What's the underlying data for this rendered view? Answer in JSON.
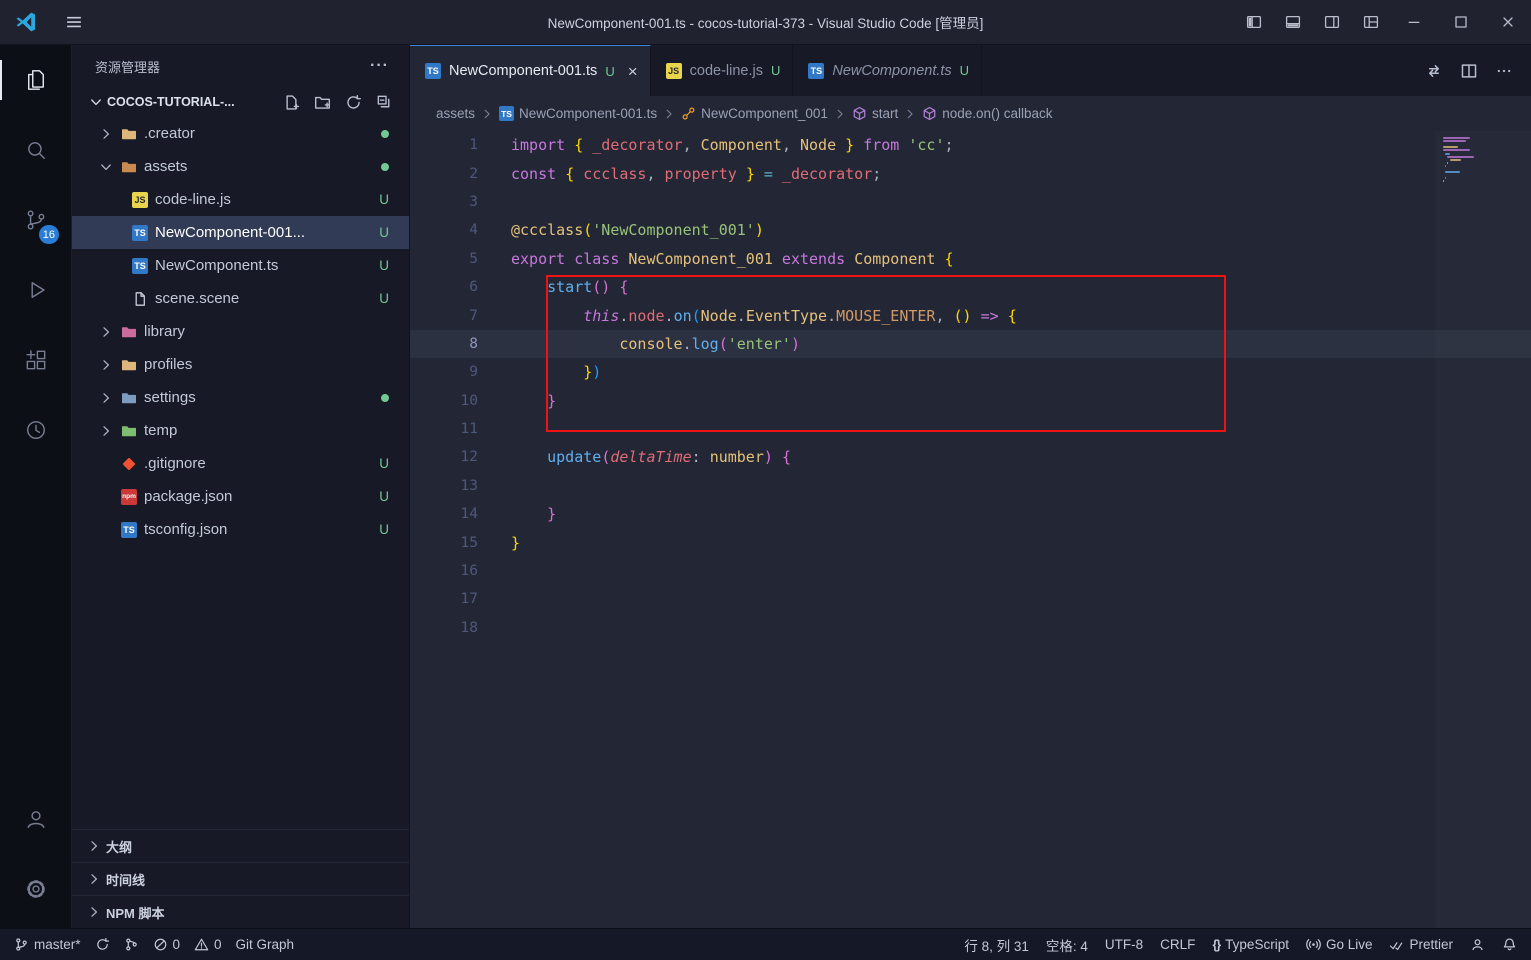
{
  "colors": {
    "accent_blue": "#3794ff",
    "badge_blue": "#2a7cd4",
    "git_green": "#73c991",
    "annotation_red": "#ee1212",
    "ts_blue": "#3178c6",
    "js_yellow": "#e8d44d",
    "npm_red": "#cb3837"
  },
  "title_bar": {
    "title": "NewComponent-001.ts - cocos-tutorial-373 - Visual Studio Code [管理员]",
    "controls": [
      "layout-sidebar-left-icon",
      "layout-panel-icon",
      "layout-sidebar-right-icon",
      "layout-customize-icon",
      "minimize-icon",
      "maximize-icon",
      "close-icon"
    ]
  },
  "activity_bar": {
    "items": [
      {
        "name": "explorer",
        "icon": "files-icon",
        "active": true
      },
      {
        "name": "search",
        "icon": "search-icon"
      },
      {
        "name": "source-control",
        "icon": "source-control-icon",
        "badge": "16"
      },
      {
        "name": "run-debug",
        "icon": "run-debug-icon"
      },
      {
        "name": "extensions",
        "icon": "extensions-icon"
      },
      {
        "name": "history",
        "icon": "history-icon"
      }
    ],
    "bottom_items": [
      {
        "name": "account",
        "icon": "account-icon"
      },
      {
        "name": "settings",
        "icon": "settings-gear-icon"
      }
    ]
  },
  "explorer": {
    "title": "资源管理器",
    "more_label": "···",
    "root": "COCOS-TUTORIAL-...",
    "root_actions": [
      "new-file-icon",
      "new-folder-icon",
      "refresh-icon",
      "collapse-all-icon"
    ],
    "items": [
      {
        "label": ".creator",
        "icon": "folder-icon",
        "color": "#dcb67a",
        "chevron": "right",
        "level": 1,
        "dot": true
      },
      {
        "label": "assets",
        "icon": "folder-icon",
        "color": "#c98a52",
        "chevron": "down",
        "level": 1,
        "dot": true
      },
      {
        "label": "code-line.js",
        "icon": "js-icon",
        "level": 2,
        "badge": "U"
      },
      {
        "label": "NewComponent-001...",
        "icon": "ts-icon",
        "level": 2,
        "badge": "U",
        "selected": true
      },
      {
        "label": "NewComponent.ts",
        "icon": "ts-icon",
        "level": 2,
        "badge": "U"
      },
      {
        "label": "scene.scene",
        "icon": "file-icon",
        "color": "#c8ccda",
        "level": 2,
        "badge": "U"
      },
      {
        "label": "library",
        "icon": "folder-icon",
        "color": "#cc6b9e",
        "chevron": "right",
        "level": 1
      },
      {
        "label": "profiles",
        "icon": "folder-icon",
        "color": "#dcb67a",
        "chevron": "right",
        "level": 1
      },
      {
        "label": "settings",
        "icon": "folder-icon",
        "color": "#7e9cc0",
        "chevron": "right",
        "level": 1,
        "dot": true
      },
      {
        "label": "temp",
        "icon": "folder-icon",
        "color": "#7ebd6f",
        "chevron": "right",
        "level": 1
      },
      {
        "label": ".gitignore",
        "icon": "git-icon",
        "color": "#f05033",
        "level": 1,
        "badge": "U"
      },
      {
        "label": "package.json",
        "icon": "npm-icon",
        "level": 1,
        "badge": "U"
      },
      {
        "label": "tsconfig.json",
        "icon": "ts-icon",
        "level": 1,
        "badge": "U"
      }
    ],
    "sections": [
      "大纲",
      "时间线",
      "NPM 脚本"
    ]
  },
  "editor": {
    "tabs": [
      {
        "label": "NewComponent-001.ts",
        "icon": "ts-icon",
        "badge": "U",
        "active": true
      },
      {
        "label": "code-line.js",
        "icon": "js-icon",
        "badge": "U"
      },
      {
        "label": "NewComponent.ts",
        "icon": "ts-icon",
        "badge": "U",
        "preview": true
      }
    ],
    "tab_actions": [
      "open-changes-icon",
      "split-editor-icon",
      "more-actions-icon"
    ],
    "breadcrumbs": [
      {
        "label": "assets"
      },
      {
        "label": "NewComponent-001.ts",
        "icon": "ts-icon"
      },
      {
        "label": "NewComponent_001",
        "icon": "symbol-class-icon",
        "icon_color": "#ee9d28"
      },
      {
        "label": "start",
        "icon": "symbol-method-icon",
        "icon_color": "#b180d7"
      },
      {
        "label": "node.on() callback",
        "icon": "symbol-method-icon",
        "icon_color": "#b180d7"
      }
    ],
    "current_line": 8,
    "token_colors": {
      "kw": "#c678dd",
      "red": "#e06c75",
      "yel": "#e5c07b",
      "str": "#98c379",
      "blue": "#61afef",
      "org": "#d19a66",
      "cyan": "#56b6c2",
      "fg": "#abb2bf",
      "b1": "#ffd700",
      "b2": "#da70d6",
      "b3": "#179fff"
    },
    "lines": [
      {
        "n": 1,
        "tokens": [
          {
            "t": "import ",
            "c": "kw"
          },
          {
            "t": "{ ",
            "c": "b1"
          },
          {
            "t": "_decorator",
            "c": "red"
          },
          {
            "t": ", ",
            "c": "fg"
          },
          {
            "t": "Component",
            "c": "yel"
          },
          {
            "t": ", ",
            "c": "fg"
          },
          {
            "t": "Node",
            "c": "yel"
          },
          {
            "t": " ",
            "c": "fg"
          },
          {
            "t": "} ",
            "c": "b1"
          },
          {
            "t": "from ",
            "c": "kw"
          },
          {
            "t": "'cc'",
            "c": "str"
          },
          {
            "t": ";",
            "c": "fg"
          }
        ]
      },
      {
        "n": 2,
        "tokens": [
          {
            "t": "const ",
            "c": "kw"
          },
          {
            "t": "{ ",
            "c": "b1"
          },
          {
            "t": "ccclass",
            "c": "red"
          },
          {
            "t": ", ",
            "c": "fg"
          },
          {
            "t": "property",
            "c": "red"
          },
          {
            "t": " ",
            "c": "fg"
          },
          {
            "t": "} ",
            "c": "b1"
          },
          {
            "t": "= ",
            "c": "cyan"
          },
          {
            "t": "_decorator",
            "c": "red"
          },
          {
            "t": ";",
            "c": "fg"
          }
        ]
      },
      {
        "n": 3,
        "tokens": []
      },
      {
        "n": 4,
        "tokens": [
          {
            "t": "@ccclass",
            "c": "yel"
          },
          {
            "t": "(",
            "c": "b1"
          },
          {
            "t": "'NewComponent_001'",
            "c": "str"
          },
          {
            "t": ")",
            "c": "b1"
          }
        ]
      },
      {
        "n": 5,
        "tokens": [
          {
            "t": "export class ",
            "c": "kw"
          },
          {
            "t": "NewComponent_001",
            "c": "yel"
          },
          {
            "t": " extends ",
            "c": "kw"
          },
          {
            "t": "Component ",
            "c": "yel"
          },
          {
            "t": "{",
            "c": "b1"
          }
        ]
      },
      {
        "n": 6,
        "tokens": [
          {
            "t": "    ",
            "c": "fg"
          },
          {
            "t": "start",
            "c": "blue"
          },
          {
            "t": "() ",
            "c": "b2"
          },
          {
            "t": "{",
            "c": "b2"
          }
        ]
      },
      {
        "n": 7,
        "tokens": [
          {
            "t": "        ",
            "c": "fg"
          },
          {
            "t": "this",
            "c": "kw",
            "i": true
          },
          {
            "t": ".",
            "c": "fg"
          },
          {
            "t": "node",
            "c": "red"
          },
          {
            "t": ".",
            "c": "fg"
          },
          {
            "t": "on",
            "c": "blue"
          },
          {
            "t": "(",
            "c": "b3"
          },
          {
            "t": "Node",
            "c": "yel"
          },
          {
            "t": ".",
            "c": "fg"
          },
          {
            "t": "EventType",
            "c": "yel"
          },
          {
            "t": ".",
            "c": "fg"
          },
          {
            "t": "MOUSE_ENTER",
            "c": "org"
          },
          {
            "t": ", ",
            "c": "fg"
          },
          {
            "t": "()",
            "c": "b1"
          },
          {
            "t": " ",
            "c": "fg"
          },
          {
            "t": "=>",
            "c": "kw"
          },
          {
            "t": " ",
            "c": "fg"
          },
          {
            "t": "{",
            "c": "b1"
          }
        ]
      },
      {
        "n": 8,
        "tokens": [
          {
            "t": "            ",
            "c": "fg"
          },
          {
            "t": "console",
            "c": "yel"
          },
          {
            "t": ".",
            "c": "fg"
          },
          {
            "t": "log",
            "c": "blue"
          },
          {
            "t": "(",
            "c": "b2"
          },
          {
            "t": "'enter'",
            "c": "str"
          },
          {
            "t": ")",
            "c": "b2"
          }
        ]
      },
      {
        "n": 9,
        "tokens": [
          {
            "t": "        ",
            "c": "fg"
          },
          {
            "t": "}",
            "c": "b1"
          },
          {
            "t": ")",
            "c": "b3"
          }
        ]
      },
      {
        "n": 10,
        "tokens": [
          {
            "t": "    ",
            "c": "fg"
          },
          {
            "t": "}",
            "c": "b2"
          }
        ]
      },
      {
        "n": 11,
        "tokens": []
      },
      {
        "n": 12,
        "tokens": [
          {
            "t": "    ",
            "c": "fg"
          },
          {
            "t": "update",
            "c": "blue"
          },
          {
            "t": "(",
            "c": "b2"
          },
          {
            "t": "deltaTime",
            "c": "red",
            "i": true
          },
          {
            "t": ": ",
            "c": "fg"
          },
          {
            "t": "number",
            "c": "yel"
          },
          {
            "t": ") ",
            "c": "b2"
          },
          {
            "t": "{",
            "c": "b2"
          }
        ]
      },
      {
        "n": 13,
        "tokens": []
      },
      {
        "n": 14,
        "tokens": [
          {
            "t": "    ",
            "c": "fg"
          },
          {
            "t": "}",
            "c": "b2"
          }
        ]
      },
      {
        "n": 15,
        "tokens": [
          {
            "t": "}",
            "c": "b1"
          }
        ]
      },
      {
        "n": 16,
        "tokens": []
      },
      {
        "n": 17,
        "tokens": []
      },
      {
        "n": 18,
        "tokens": []
      }
    ]
  },
  "status_bar": {
    "left": [
      {
        "name": "branch-indicator",
        "icon": "branch-icon",
        "label": "master*"
      },
      {
        "name": "sync-button",
        "icon": "sync-icon"
      },
      {
        "name": "commit-graph-button",
        "icon": "graph-icon"
      },
      {
        "name": "problems-errors",
        "icon": "error-icon",
        "label": "0"
      },
      {
        "name": "problems-warnings",
        "icon": "warning-icon",
        "label": "0"
      },
      {
        "name": "git-graph-button",
        "label": "Git Graph"
      }
    ],
    "right": [
      {
        "name": "cursor-position",
        "label": "行 8, 列 31"
      },
      {
        "name": "indentation",
        "label": "空格: 4"
      },
      {
        "name": "encoding",
        "label": "UTF-8"
      },
      {
        "name": "eol",
        "label": "C​RLF"
      },
      {
        "name": "language-mode",
        "icon": "braces-icon",
        "label": "TypeScript"
      },
      {
        "name": "go-live",
        "icon": "broadcast-icon",
        "label": "Go Live"
      },
      {
        "name": "prettier",
        "icon": "check-icon",
        "label": "Prettier"
      },
      {
        "name": "feedback",
        "icon": "person-icon"
      },
      {
        "name": "notifications",
        "icon": "bell-icon"
      }
    ]
  }
}
